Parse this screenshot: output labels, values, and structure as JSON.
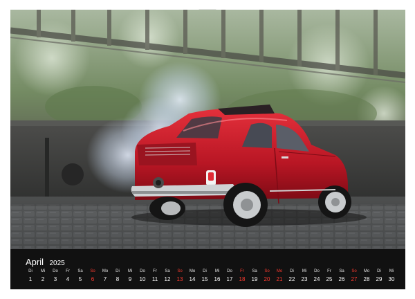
{
  "calendar": {
    "month": "April",
    "year": "2025",
    "sunday_color": "#ff3b30",
    "days": [
      {
        "dow": "Di",
        "num": "1"
      },
      {
        "dow": "Mi",
        "num": "2"
      },
      {
        "dow": "Do",
        "num": "3"
      },
      {
        "dow": "Fr",
        "num": "4"
      },
      {
        "dow": "Sa",
        "num": "5"
      },
      {
        "dow": "So",
        "num": "6",
        "sunday": true
      },
      {
        "dow": "Mo",
        "num": "7"
      },
      {
        "dow": "Di",
        "num": "8"
      },
      {
        "dow": "Mi",
        "num": "9"
      },
      {
        "dow": "Do",
        "num": "10"
      },
      {
        "dow": "Fr",
        "num": "11"
      },
      {
        "dow": "Sa",
        "num": "12"
      },
      {
        "dow": "So",
        "num": "13",
        "sunday": true
      },
      {
        "dow": "Mo",
        "num": "14"
      },
      {
        "dow": "Di",
        "num": "15"
      },
      {
        "dow": "Mi",
        "num": "16"
      },
      {
        "dow": "Do",
        "num": "17"
      },
      {
        "dow": "Fr",
        "num": "18",
        "sunday": true
      },
      {
        "dow": "Sa",
        "num": "19"
      },
      {
        "dow": "So",
        "num": "20",
        "sunday": true
      },
      {
        "dow": "Mo",
        "num": "21",
        "sunday": true
      },
      {
        "dow": "Di",
        "num": "22"
      },
      {
        "dow": "Mi",
        "num": "23"
      },
      {
        "dow": "Do",
        "num": "24"
      },
      {
        "dow": "Fr",
        "num": "25"
      },
      {
        "dow": "Sa",
        "num": "26"
      },
      {
        "dow": "So",
        "num": "27",
        "sunday": true
      },
      {
        "dow": "Mo",
        "num": "28"
      },
      {
        "dow": "Di",
        "num": "29"
      },
      {
        "dow": "Mi",
        "num": "30"
      }
    ]
  }
}
